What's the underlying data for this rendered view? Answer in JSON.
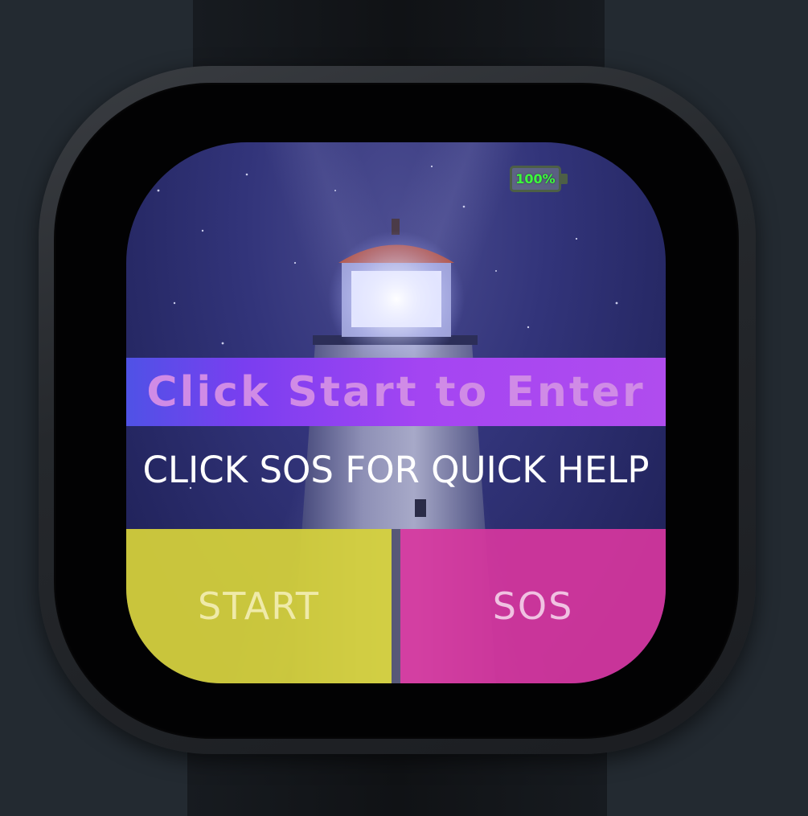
{
  "app": {
    "name": "SOS lighthouse watch face"
  },
  "status": {
    "battery_percent": "100%"
  },
  "banner": {
    "text": "Click Start to Enter"
  },
  "hint": {
    "text": "CLICK SOS FOR QUICK HELP"
  },
  "buttons": {
    "start_label": "START",
    "sos_label": "SOS"
  },
  "colors": {
    "background": "#232a31",
    "banner_gradient_start": "#4f52e6",
    "banner_gradient_end": "#b04cee",
    "start_button": "#d6d23a",
    "sos_button": "#d7369e",
    "battery_text": "#3cff3c"
  },
  "icons": {
    "battery": "battery-icon",
    "background_image": "lighthouse-night-image"
  }
}
